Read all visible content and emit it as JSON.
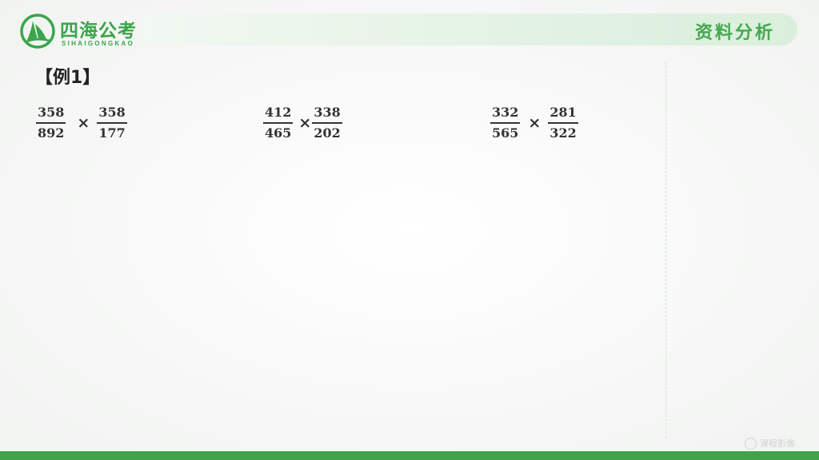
{
  "logo": {
    "text_cn": "四海公考",
    "text_en": "SIHAIGONGKAO",
    "icon": "sailboat-logo-icon"
  },
  "header": {
    "section_title": "资料分析"
  },
  "example": {
    "label": "【例1】"
  },
  "expressions": [
    {
      "num1": "358",
      "den1": "892",
      "op": "×",
      "num2": "358",
      "den2": "177"
    },
    {
      "num1": "412",
      "den1": "465",
      "op": "×",
      "num2": "338",
      "den2": "202"
    },
    {
      "num1": "332",
      "den1": "565",
      "op": "×",
      "num2": "281",
      "den2": "322"
    }
  ],
  "watermark": {
    "text": "课程影像"
  },
  "colors": {
    "brand_green": "#3aa54a",
    "header_bar": "#dff1e0",
    "bottom_bar": "#3fa34c"
  }
}
